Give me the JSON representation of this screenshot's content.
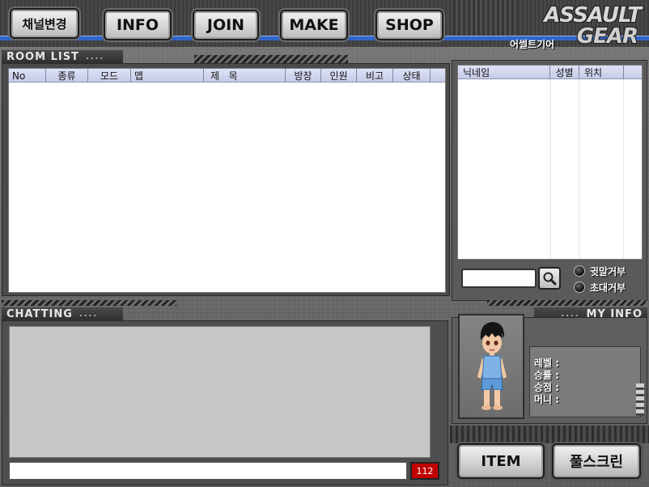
{
  "nav": {
    "channel_label": "채널변경",
    "info_label": "INFO",
    "join_label": "JOIN",
    "make_label": "MAKE",
    "shop_label": "SHOP"
  },
  "logo": {
    "line1": "ASSAULT",
    "line2": "GEAR",
    "korean": "어썰트기어"
  },
  "room_list": {
    "title": "ROOM LIST",
    "columns": [
      "No",
      "종류",
      "모드",
      "맵",
      "제   목",
      "방장",
      "인원",
      "비고",
      "상태"
    ],
    "rows": []
  },
  "user_list": {
    "columns": [
      "닉네임",
      "성별",
      "위치"
    ],
    "rows": []
  },
  "search": {
    "value": ""
  },
  "options": {
    "whisper_block": "귓말거부",
    "invite_block": "초대거부"
  },
  "chat": {
    "title": "CHATTING",
    "input_value": "",
    "remaining": "112"
  },
  "my_info": {
    "title": "MY INFO",
    "level_label": "레벨 :",
    "winrate_label": "승률 :",
    "wins_label": "승점 :",
    "money_label": "머니 :"
  },
  "buttons": {
    "item_label": "ITEM",
    "fullscreen_label": "풀스크린"
  },
  "colors": {
    "accent_blue": "#2f66c8",
    "header_blue": "#c5cbe8",
    "counter_red": "#c00000"
  }
}
